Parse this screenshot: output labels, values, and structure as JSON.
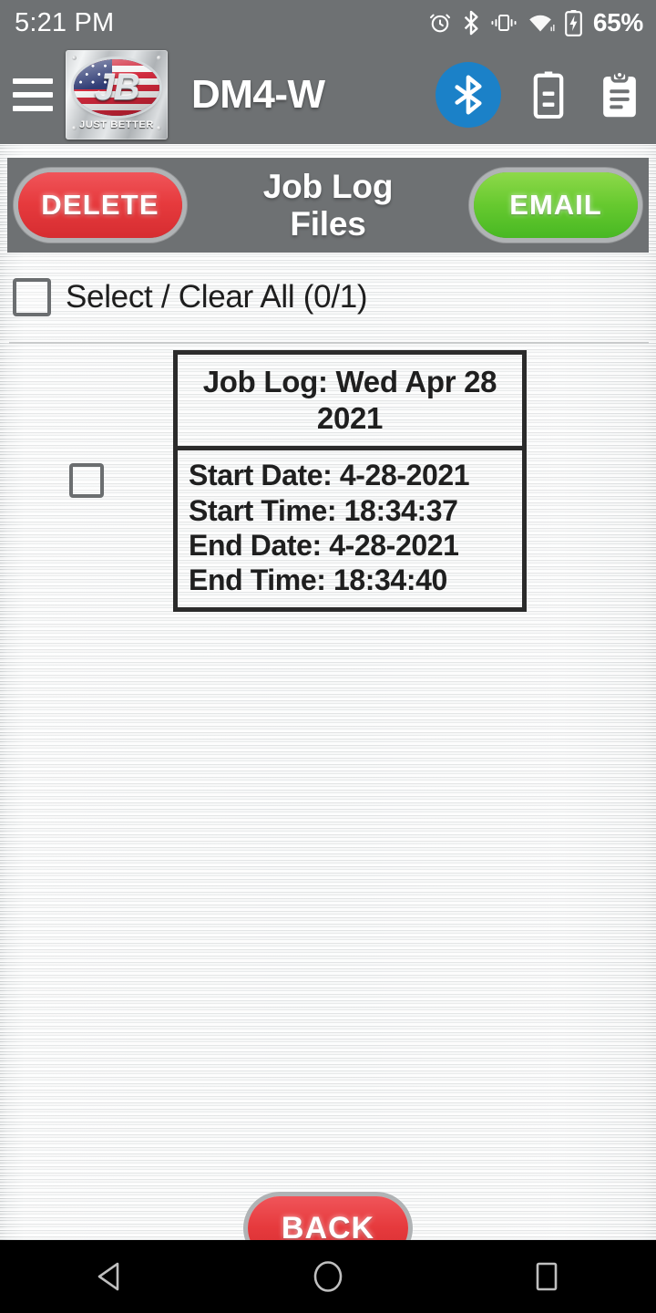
{
  "status_bar": {
    "time": "5:21 PM",
    "battery_percent": "65%",
    "icons": [
      "alarm-icon",
      "bluetooth-icon",
      "vibrate-icon",
      "wifi-icon",
      "battery-charging-icon"
    ]
  },
  "app_bar": {
    "menu_icon": "hamburger-menu-icon",
    "logo": {
      "mark": "JB",
      "tagline": "JUST BETTER"
    },
    "title": "DM4-W",
    "bluetooth_icon": "bluetooth-icon",
    "battery_icon": "battery-icon",
    "clipboard_icon": "clipboard-icon",
    "bluetooth_circle_color": "#1b81c8",
    "bar_color": "#6e7173"
  },
  "toolbar": {
    "delete_label": "DELETE",
    "email_label": "EMAIL",
    "title_line1": "Job Log",
    "title_line2": "Files",
    "delete_color": "#e63a3d",
    "email_color": "#66c92f"
  },
  "select_all": {
    "label": "Select / Clear All (0/1)",
    "checked": false
  },
  "files": [
    {
      "checked": false,
      "title": "Job Log: Wed Apr 28 2021",
      "fields": [
        "Start Date: 4-28-2021",
        "Start Time: 18:34:37",
        "End Date: 4-28-2021",
        "End Time: 18:34:40"
      ]
    }
  ],
  "footer": {
    "back_label": "BACK",
    "back_color": "#e63a3d"
  },
  "nav_bar": {
    "back_icon": "triangle-back-icon",
    "home_icon": "circle-home-icon",
    "recents_icon": "square-recents-icon"
  }
}
